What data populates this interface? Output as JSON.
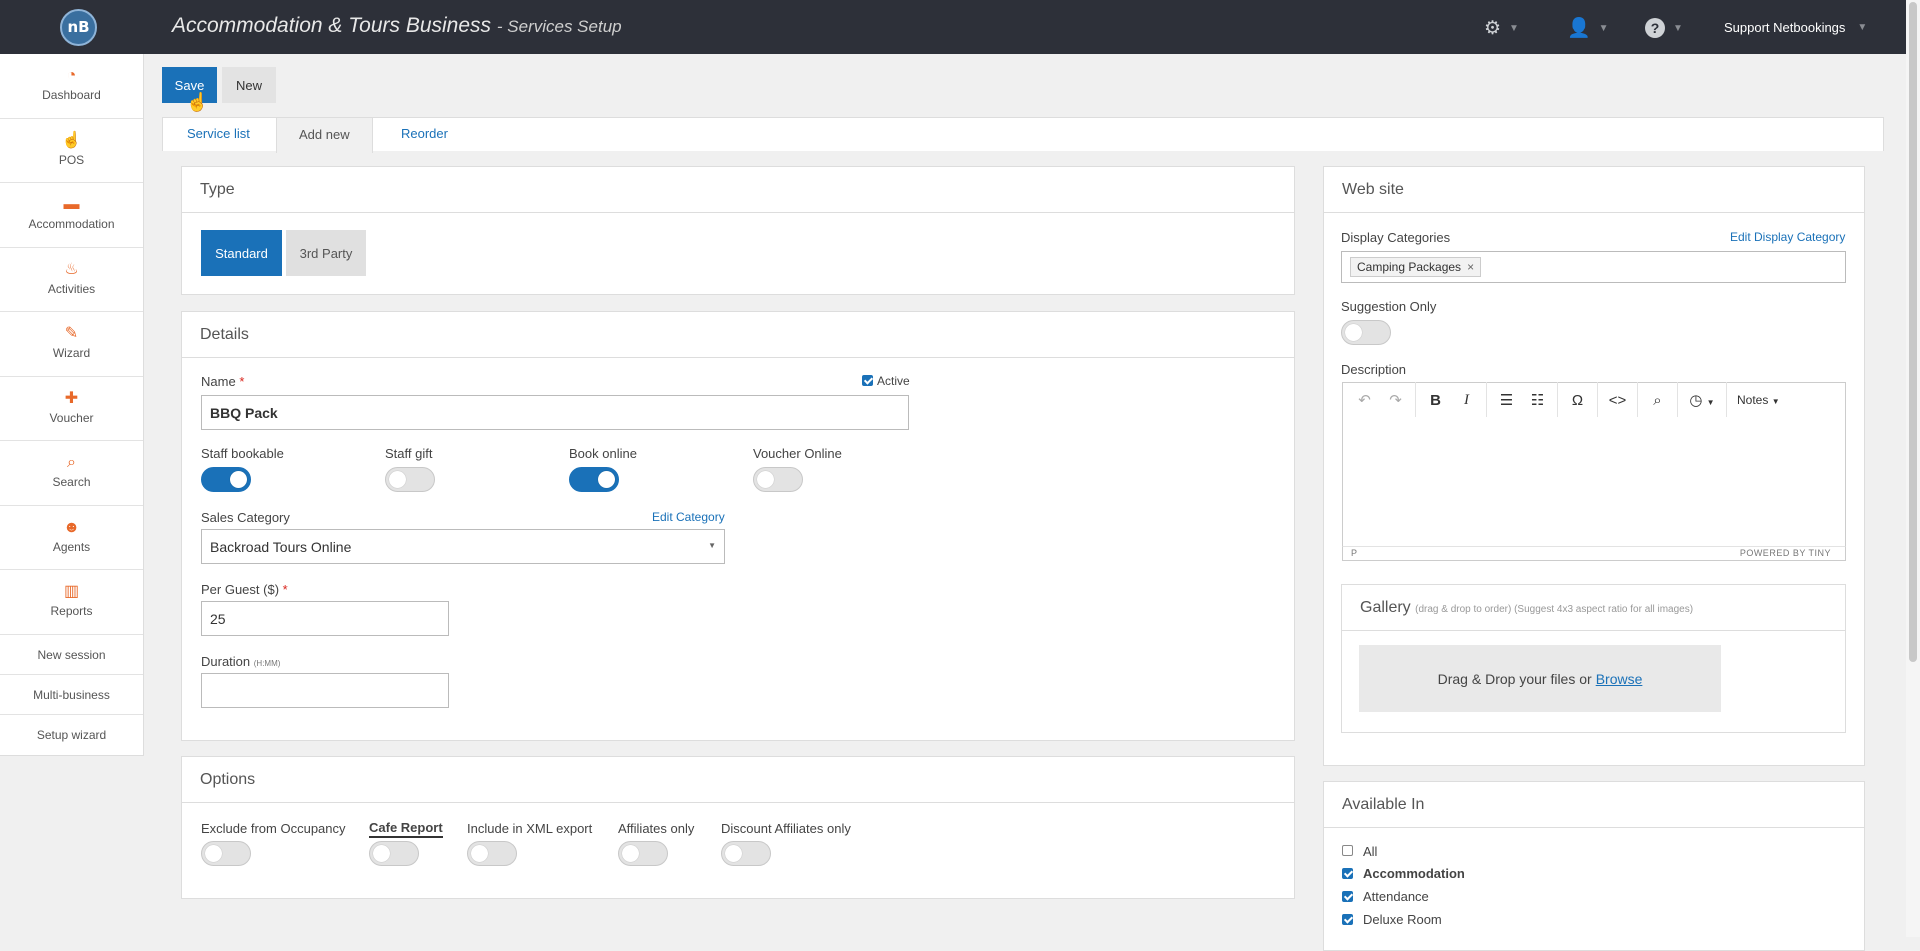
{
  "header": {
    "logo": "nB",
    "title": "Accommodation & Tours Business",
    "subtitle": "- Services Setup",
    "user": "Support Netbookings"
  },
  "sidebar": {
    "items": [
      {
        "label": "Dashboard",
        "icon": "dashboard-icon"
      },
      {
        "label": "POS",
        "icon": "pointer-hand-icon"
      },
      {
        "label": "Accommodation",
        "icon": "bed-icon"
      },
      {
        "label": "Activities",
        "icon": "activities-icon"
      },
      {
        "label": "Wizard",
        "icon": "magic-wand-icon"
      },
      {
        "label": "Voucher",
        "icon": "gift-icon"
      },
      {
        "label": "Search",
        "icon": "search-icon"
      },
      {
        "label": "Agents",
        "icon": "agent-icon"
      },
      {
        "label": "Reports",
        "icon": "bar-chart-icon"
      }
    ],
    "links": [
      "New session",
      "Multi-business",
      "Setup wizard"
    ]
  },
  "toolbar": {
    "save": "Save",
    "new": "New"
  },
  "tabs": {
    "list": "Service list",
    "add": "Add new",
    "reorder": "Reorder"
  },
  "type_panel": {
    "title": "Type",
    "standard": "Standard",
    "third_party": "3rd Party"
  },
  "details": {
    "title": "Details",
    "name_label": "Name",
    "required": "*",
    "active_label": "Active",
    "name_value": "BBQ Pack",
    "staff_bookable": "Staff bookable",
    "staff_gift": "Staff gift",
    "book_online": "Book online",
    "voucher_online": "Voucher Online",
    "sales_category_label": "Sales Category",
    "edit_category": "Edit Category",
    "sales_category_value": "Backroad Tours Online",
    "per_guest_label": "Per Guest ($)",
    "per_guest_value": "25",
    "duration_label": "Duration",
    "duration_hint": "(H:MM)",
    "duration_value": ""
  },
  "options": {
    "title": "Options",
    "exclude": "Exclude from Occupancy",
    "cafe": "Cafe Report",
    "xml": "Include in XML export",
    "affiliates": "Affiliates only",
    "discount": "Discount Affiliates only"
  },
  "website": {
    "title": "Web site",
    "display_categories": "Display Categories",
    "edit_display_category": "Edit Display Category",
    "tag": "Camping Packages",
    "tag_remove": "×",
    "suggestion_only": "Suggestion Only",
    "description": "Description",
    "editor_notes": "Notes",
    "editor_path": "P",
    "powered": "POWERED BY TINY"
  },
  "gallery": {
    "title": "Gallery",
    "hint": "(drag & drop to order) (Suggest 4x3 aspect ratio for all images)",
    "drop_text": "Drag & Drop your files or",
    "browse": "Browse"
  },
  "available_in": {
    "title": "Available In",
    "items": [
      {
        "label": "All",
        "checked": false
      },
      {
        "label": "Accommodation",
        "checked": true
      },
      {
        "label": "Attendance",
        "checked": true
      },
      {
        "label": "Deluxe Room",
        "checked": true
      }
    ]
  },
  "colors": {
    "accent": "#1a71b8",
    "topbar": "#2d3039",
    "sidebar_icon": "#e8692a"
  }
}
